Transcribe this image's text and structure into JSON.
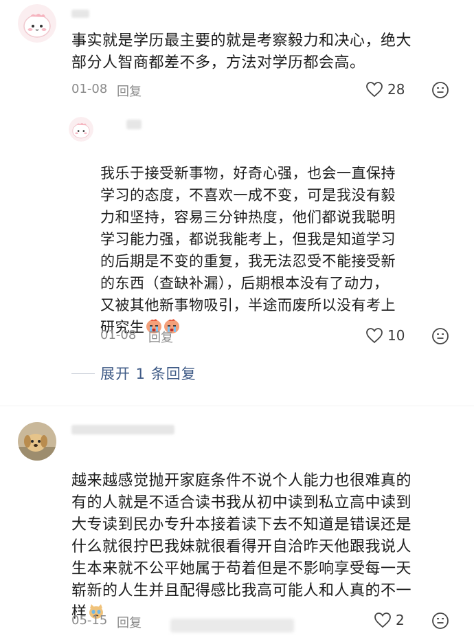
{
  "comments": [
    {
      "username": "",
      "text": "事实就是学历最主要的就是考察毅力和决心，绝大\n部分人智商都差不多，方法对学历都会高。",
      "date": "01-08",
      "reply_label": "回复",
      "likes": "28",
      "replies": [
        {
          "username": "",
          "text": "我乐于接受新事物，好奇心强，也会一直保持\n学习的态度，不喜欢一成不变，可是我没有毅\n力和坚持，容易三分钟热度，他们都说我聪明\n学习能力强，都说我能考上，但我是知道学习\n的后期是不变的重复，我无法忍受不能接受新\n的东西（查缺补漏），后期根本没有了动力，\n又被其他新事物吸引，半途而废所以没有考上\n研究生",
          "date": "01-08",
          "reply_label": "回复",
          "likes": "10"
        }
      ],
      "expand_label": "展开 1 条回复"
    },
    {
      "username": "",
      "text": "越来越感觉抛开家庭条件不说个人能力也很难真的\n有的人就是不适合读书我从初中读到私立高中读到\n大专读到民办专升本接着读下去不知道是错误还是\n什么就很拧巴我妹就很看得开自洽昨天他跟我说人\n生本来就不公平她属于苟着但是不影响享受每一天\n崭新的人生并且配得感比我高可能人和人真的不一\n样",
      "date": "05-15",
      "reply_label": "回复",
      "likes": "2"
    }
  ],
  "icons": {
    "like": "heart-outline-icon",
    "react": "emoji-face-icon",
    "crying": "crying-face-emoji",
    "cat": "crying-cat-emoji"
  },
  "colors": {
    "link": "#3e5a86",
    "meta": "#8a8a8a",
    "text": "#1c1c1c"
  }
}
